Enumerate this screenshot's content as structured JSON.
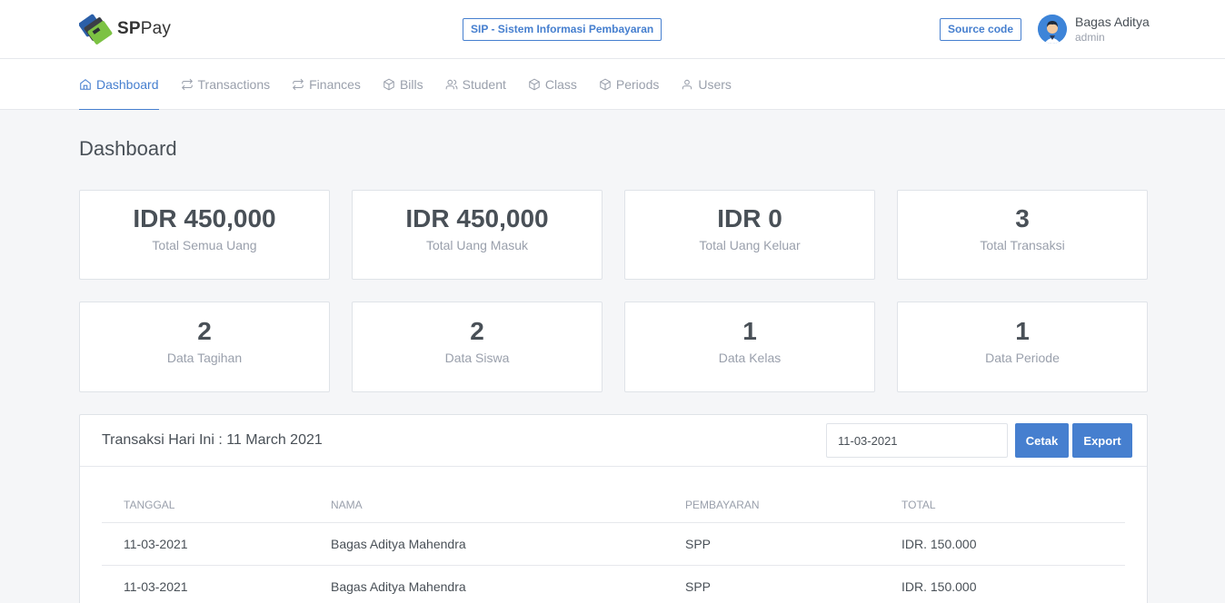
{
  "brand": {
    "name_bold": "SP",
    "name_rest": "Pay"
  },
  "header": {
    "sip_badge": "SIP - Sistem Informasi Pembayaran",
    "source_button": "Source code",
    "user": {
      "name": "Bagas Aditya",
      "role": "admin"
    }
  },
  "nav": {
    "items": [
      {
        "label": "Dashboard",
        "icon": "home-icon"
      },
      {
        "label": "Transactions",
        "icon": "repeat-icon"
      },
      {
        "label": "Finances",
        "icon": "repeat-icon"
      },
      {
        "label": "Bills",
        "icon": "box-icon"
      },
      {
        "label": "Student",
        "icon": "users-icon"
      },
      {
        "label": "Class",
        "icon": "box-icon"
      },
      {
        "label": "Periods",
        "icon": "box-icon"
      },
      {
        "label": "Users",
        "icon": "user-icon"
      }
    ]
  },
  "page": {
    "title": "Dashboard"
  },
  "stats": [
    {
      "value": "IDR 450,000",
      "label": "Total Semua Uang"
    },
    {
      "value": "IDR 450,000",
      "label": "Total Uang Masuk"
    },
    {
      "value": "IDR 0",
      "label": "Total Uang Keluar"
    },
    {
      "value": "3",
      "label": "Total Transaksi"
    },
    {
      "value": "2",
      "label": "Data Tagihan"
    },
    {
      "value": "2",
      "label": "Data Siswa"
    },
    {
      "value": "1",
      "label": "Data Kelas"
    },
    {
      "value": "1",
      "label": "Data Periode"
    }
  ],
  "transactions": {
    "title": "Transaksi Hari Ini : 11 March 2021",
    "date_value": "11-03-2021",
    "print_button": "Cetak",
    "export_button": "Export",
    "columns": [
      "TANGGAL",
      "NAMA",
      "PEMBAYARAN",
      "TOTAL"
    ],
    "rows": [
      [
        "11-03-2021",
        "Bagas Aditya Mahendra",
        "SPP",
        "IDR. 150.000"
      ],
      [
        "11-03-2021",
        "Bagas Aditya Mahendra",
        "SPP",
        "IDR. 150.000"
      ]
    ]
  },
  "colors": {
    "accent": "#467fcf",
    "muted": "#9aa0ac",
    "text": "#495057"
  }
}
